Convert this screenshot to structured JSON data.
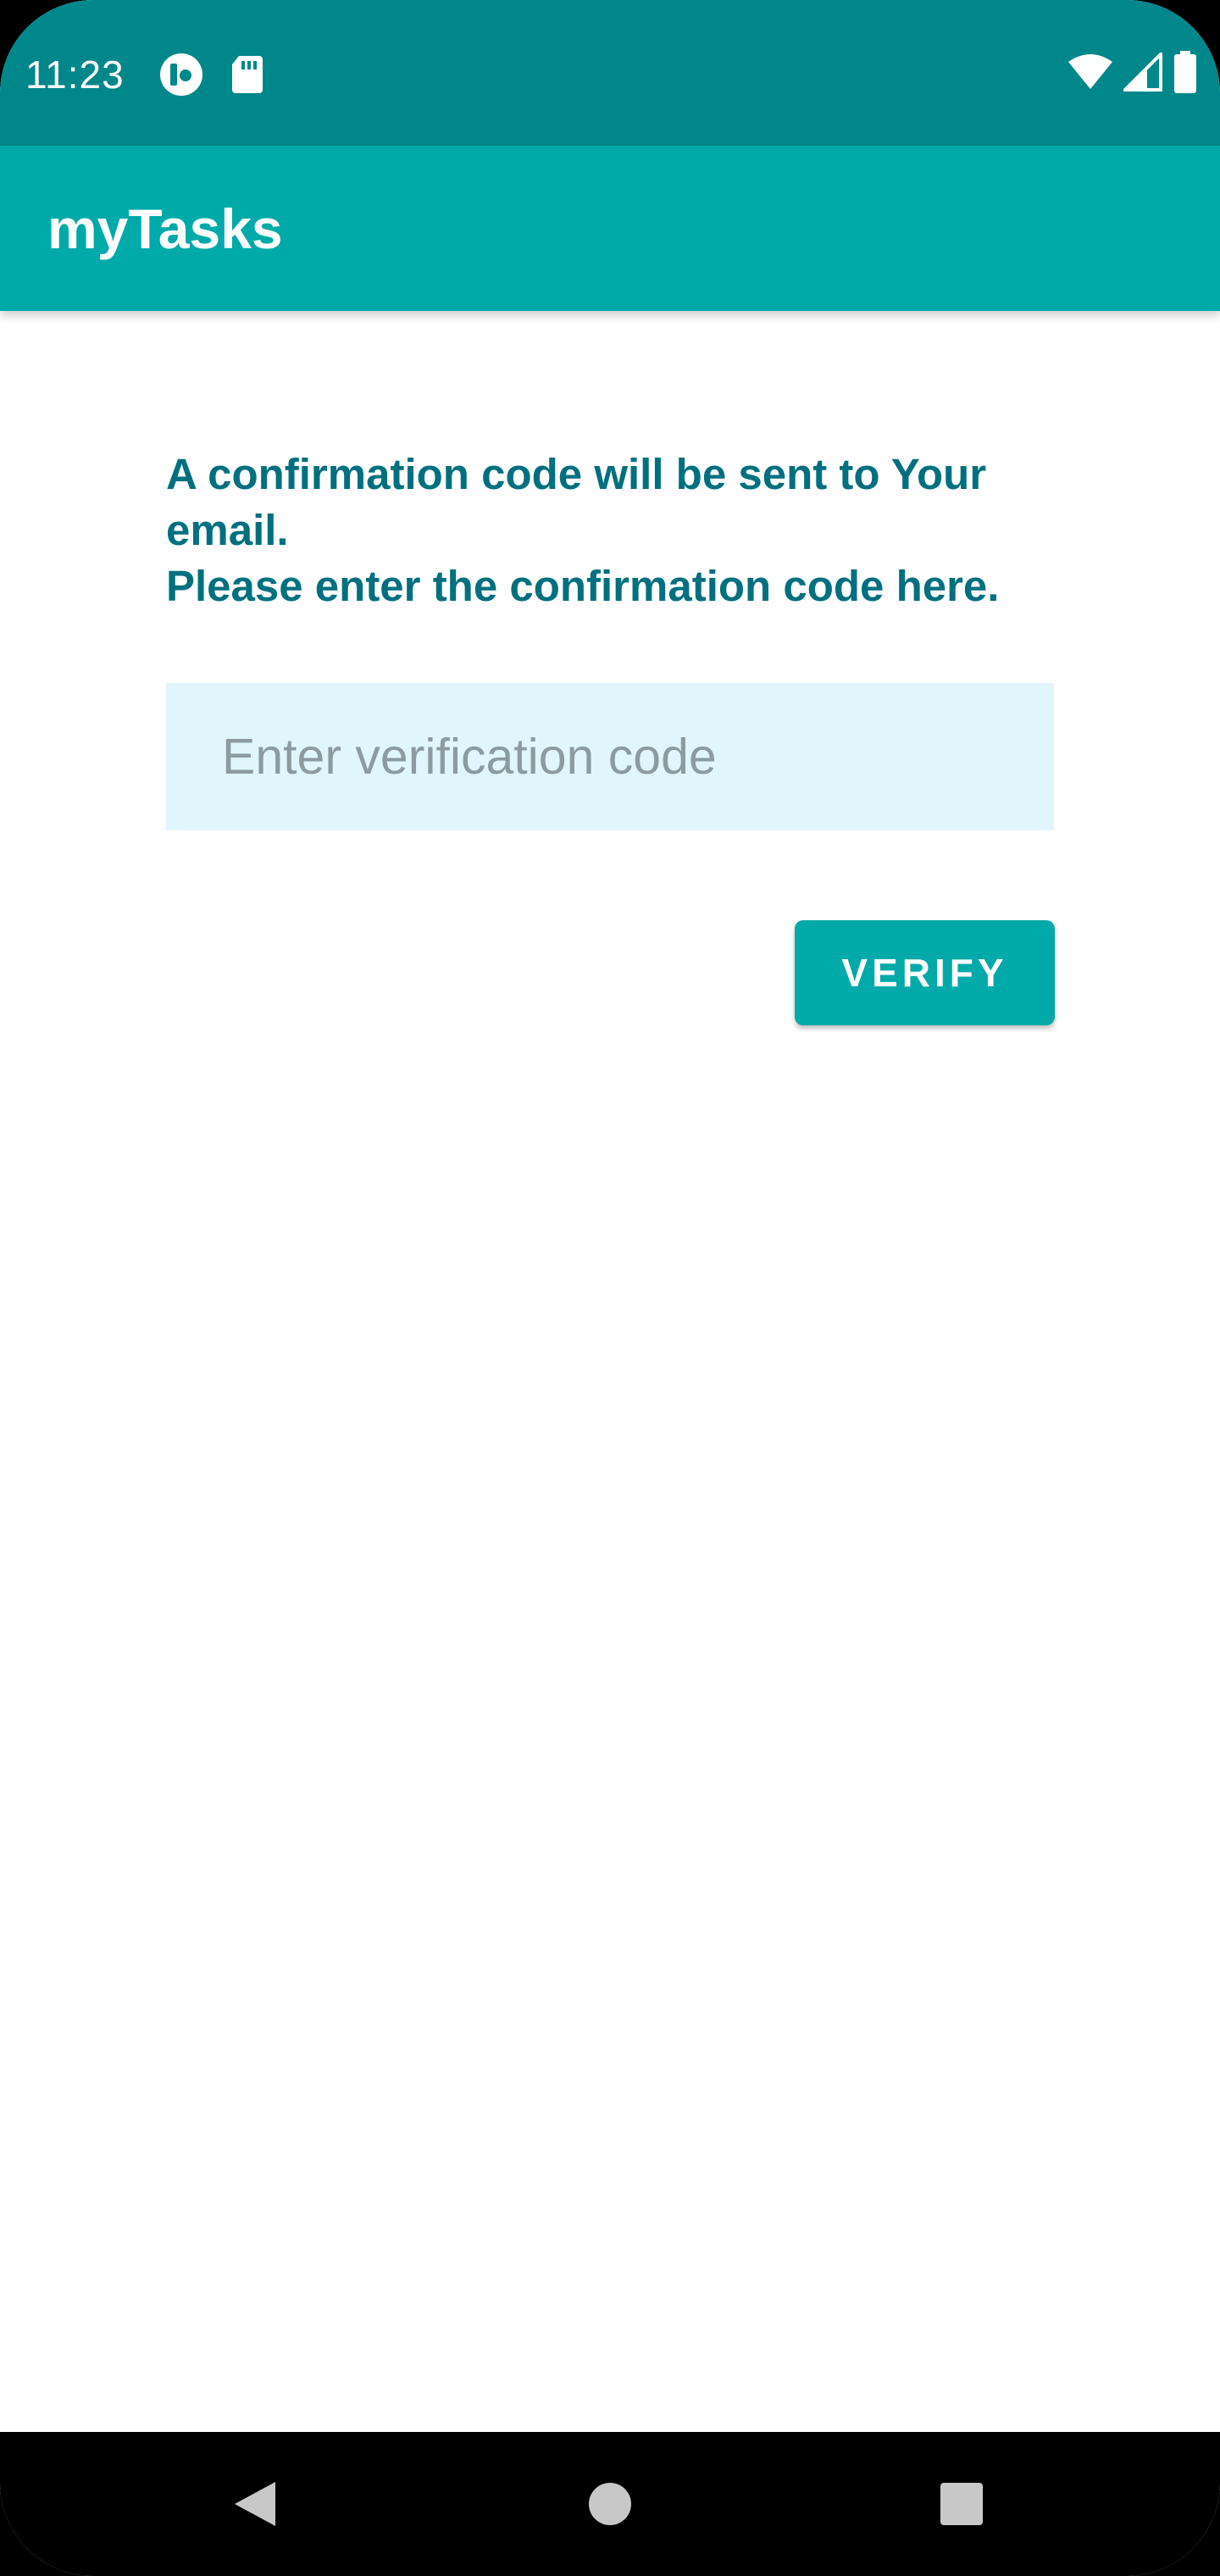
{
  "status_bar": {
    "time": "11:23",
    "left_icons": [
      "app-notification-icon",
      "sd-card-icon"
    ],
    "right_icons": [
      "wifi-icon",
      "cell-signal-icon",
      "battery-icon"
    ]
  },
  "app_bar": {
    "title": "myTasks"
  },
  "verification": {
    "instruction_line1": "A confirmation code will be sent to Your email.",
    "instruction_line2": "Please enter the confirmation code here.",
    "code_placeholder": "Enter verification code",
    "code_value": "",
    "verify_label": "VERIFY"
  },
  "nav_bar": {
    "buttons": [
      "back-icon",
      "home-icon",
      "recents-icon"
    ]
  },
  "colors": {
    "status_bar": "#00878a",
    "app_bar": "#00aaa9",
    "instruction_text": "#00707e",
    "input_background": "#e1f5fd",
    "button": "#00aaa9"
  }
}
